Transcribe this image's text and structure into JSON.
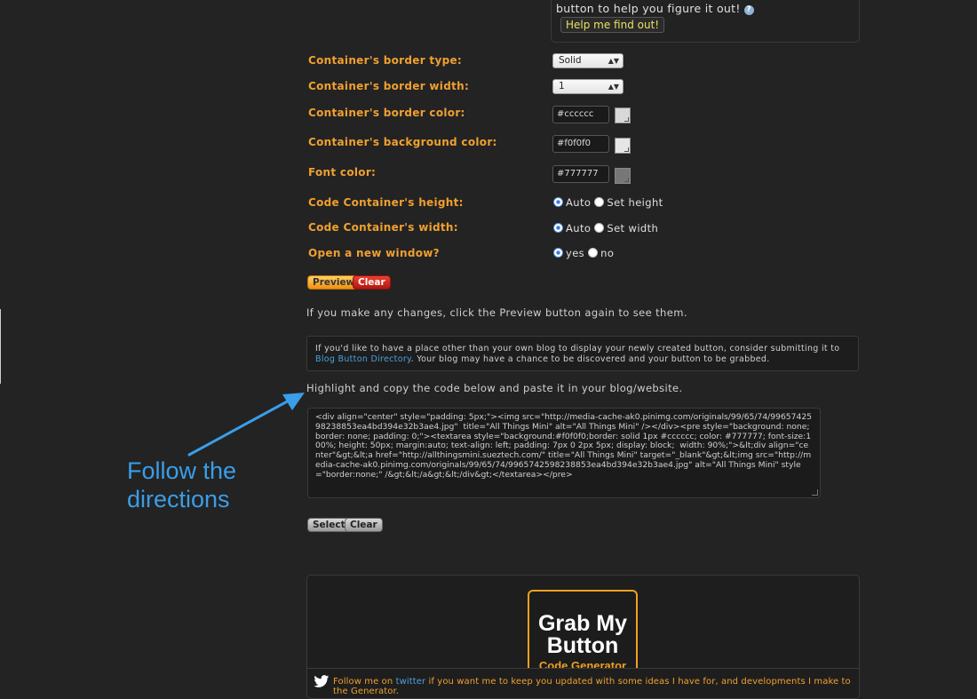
{
  "top": {
    "text": "button to help you figure it out!",
    "help_button": "Help me find out!"
  },
  "form": {
    "border_type": {
      "label": "Container's border type:",
      "value": "Solid"
    },
    "border_width": {
      "label": "Container's border width:",
      "value": "1"
    },
    "border_color": {
      "label": "Container's border color:",
      "value": "#cccccc",
      "swatch": "#d8d8d8"
    },
    "bg_color": {
      "label": "Container's background color:",
      "value": "#f0f0f0",
      "swatch": "#e6e6e6"
    },
    "font_color": {
      "label": "Font color:",
      "value": "#777777",
      "swatch": "#777777"
    },
    "height": {
      "label": "Code Container's height:",
      "opt1": "Auto",
      "opt2": "Set height"
    },
    "width": {
      "label": "Code Container's width:",
      "opt1": "Auto",
      "opt2": "Set width"
    },
    "new_window": {
      "label": "Open a new window?",
      "opt1": "yes",
      "opt2": "no"
    }
  },
  "buttons": {
    "preview": "Preview",
    "clear": "Clear",
    "select": "Select",
    "clear2": "Clear"
  },
  "messages": {
    "changes": "If you make any changes, click the Preview button again to see them.",
    "notice_before": "If you'd like to have a place other than your own blog to display your newly created button, consider submitting it to ",
    "notice_link": "Blog Button Directory",
    "notice_after": ". Your blog may have a chance to be discovered and your button to be grabbed.",
    "copy": "Highlight and copy the code below and paste it in your blog/website."
  },
  "code": "<div align=\"center\" style=\"padding: 5px;\"><img src=\"http://media-cache-ak0.pinimg.com/originals/99/65/74/9965742598238853ea4bd394e32b3ae4.jpg\"  title=\"All Things Mini\" alt=\"All Things Mini\" /></div><pre style=\"background: none; border: none; padding: 0;\"><textarea style=\"background:#f0f0f0;border: solid 1px #cccccc; color: #777777; font-size:100%; height: 50px; margin:auto; text-align: left; padding: 7px 0 2px 5px; display: block;  width: 90%;\">&lt;div align=\"center\"&gt;&lt;a href=\"http://allthingsmini.sueztech.com/\" title=\"All Things Mini\" target=\"_blank\"&gt;&lt;img src=\"http://media-cache-ak0.pinimg.com/originals/99/65/74/9965742598238853ea4bd394e32b3ae4.jpg\" alt=\"All Things Mini\" style=\"border:none;\" /&gt;&lt;/a&gt;&lt;/div&gt;</textarea></pre>",
  "annotation": {
    "line1": "Follow the",
    "line2": "directions"
  },
  "logo": {
    "line1": "Grab My",
    "line2": "Button",
    "line3": "Code Generator"
  },
  "footer": {
    "before": "Follow me on ",
    "link": "twitter",
    "after": " if you want me to keep you updated with some ideas I have for, and developments I make to the Generator."
  },
  "colors": {
    "accent_orange": "#f0a030",
    "link_blue": "#4aa0e0",
    "annotation_blue": "#3a9ee8"
  }
}
